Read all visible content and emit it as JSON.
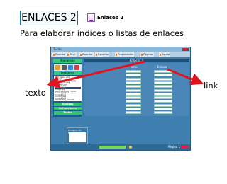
{
  "slide": {
    "title": "ENLACES 2",
    "tool_label": "Enlaces 2",
    "description": "Para elaborar índices o listas de enlaces",
    "label_texto": "texto",
    "label_link": "link"
  },
  "app": {
    "window_title": "Tucán",
    "toolbar": [
      {
        "label": "Guardar"
      },
      {
        "label": "Abrir"
      },
      {
        "label": "Guardar"
      },
      {
        "label": "Exportar"
      },
      {
        "label": "Propiedades"
      },
      {
        "label": "Páginas"
      },
      {
        "label": "Ayuda"
      }
    ],
    "sidebar": {
      "header": "Recursos",
      "section": "Imágenes",
      "items": [
        {
          "label": "01_Hojas1.jpg"
        },
        {
          "label": "TG.jpg"
        },
        {
          "label": "_DSC0477 hojas.jpg"
        },
        {
          "label": "cuadernos.jpg"
        },
        {
          "label": "ejemplo.jpg"
        },
        {
          "label": "arrows.jpg"
        },
        {
          "label": "enlace.jpg"
        },
        {
          "label": "dibujo.jpg"
        },
        {
          "label": "alaco.ab2.jpg Fondo"
        },
        {
          "label": "fondo1.jpg"
        },
        {
          "label": "fondo2.jpg"
        },
        {
          "label": "fondo3.jpg"
        },
        {
          "label": "fondo4.jpg"
        },
        {
          "label": "ARCHIVOS_TUCÁN"
        }
      ],
      "footers": [
        "Sonidos",
        "Animaciones",
        "Textos"
      ]
    },
    "main_title": "Enlaces 2",
    "column_texto": "Texto",
    "column_enlace": "Enlace",
    "field_rows": 12,
    "bottom_panel_label": "Imagen de fondo",
    "page_indicator": "Página 1"
  },
  "colors": {
    "arrow": "#e0141f",
    "window_bg": "#3e7fb0",
    "sidebar_green": "#37c97a"
  }
}
